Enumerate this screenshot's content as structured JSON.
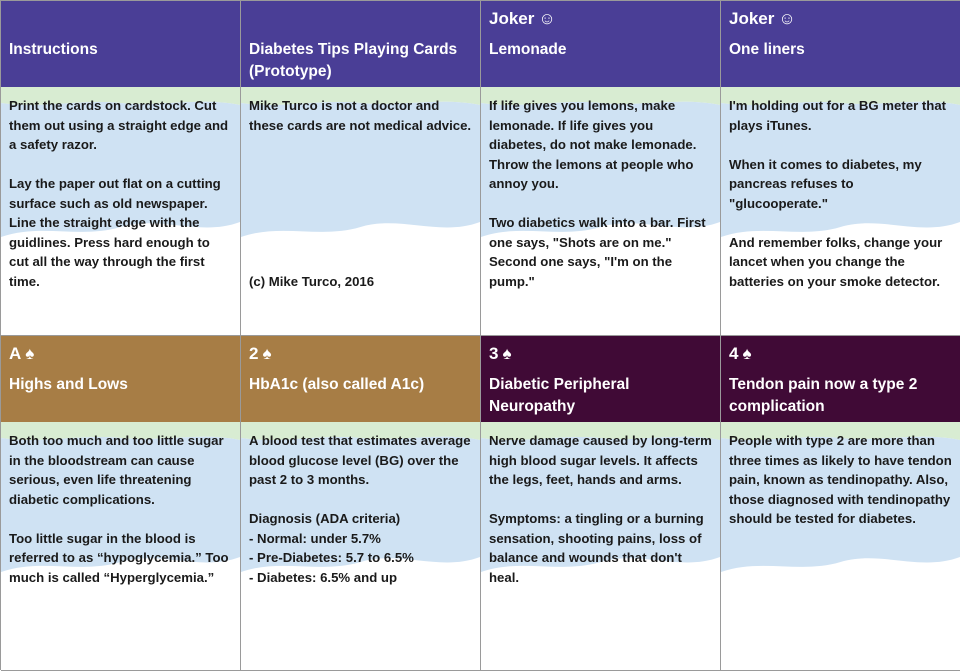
{
  "cards": [
    {
      "rank": "",
      "title": "Instructions",
      "body": [
        "Print the cards on cardstock. Cut them out using a straight edge and a safety razor.",
        "Lay the paper out flat on a cutting surface such as old newspaper. Line the straight edge with the guidlines. Press hard enough to cut all the way through the first time."
      ],
      "footer": "",
      "header_color": "#4a3e96"
    },
    {
      "rank": "",
      "title": "Diabetes Tips Playing Cards (Prototype)",
      "body": [
        "Mike Turco is not a doctor and these cards are not medical advice."
      ],
      "footer": "(c) Mike Turco, 2016",
      "header_color": "#4a3e96"
    },
    {
      "rank": "Joker",
      "rank_symbol": "☺",
      "title": "Lemonade",
      "body": [
        "If life gives you lemons, make lemonade. If life gives you diabetes, do not make lemonade. Throw the lemons at people who annoy you.",
        "Two diabetics walk into a bar. First one says, \"Shots are on me.\" Second one says, \"I'm on the pump.\""
      ],
      "footer": "",
      "header_color": "#4a3e96"
    },
    {
      "rank": "Joker",
      "rank_symbol": "☺",
      "title": "One liners",
      "body": [
        "I'm holding out for a BG meter that plays iTunes.",
        "When it comes to diabetes, my pancreas refuses to \"glucooperate.\"",
        "And remember folks, change your lancet when you change the batteries on your smoke detector."
      ],
      "footer": "",
      "header_color": "#4a3e96"
    },
    {
      "rank": "A",
      "rank_symbol": "♠",
      "title": "Highs and Lows",
      "body": [
        "Both too much and too little sugar in the bloodstream can cause serious, even life threatening diabetic complications.",
        "Too little sugar in the blood is referred to as “hypoglycemia.” Too much is called “Hyperglycemia.”"
      ],
      "footer": "",
      "header_color": "#a77d45"
    },
    {
      "rank": "2",
      "rank_symbol": "♠",
      "title": "HbA1c (also called A1c)",
      "body": [
        "A blood test that estimates average blood glucose level (BG) over the past 2 to 3 months.",
        "Diagnosis (ADA criteria)\n- Normal: under 5.7%\n- Pre-Diabetes: 5.7 to 6.5%\n- Diabetes: 6.5% and up"
      ],
      "footer": "",
      "header_color": "#a77d45"
    },
    {
      "rank": "3",
      "rank_symbol": "♠",
      "title": "Diabetic Peripheral Neuropathy",
      "body": [
        "Nerve damage caused by long-term high blood sugar levels. It affects the legs, feet, hands and arms.",
        "Symptoms: a tingling or a burning sensation, shooting pains, loss of balance and wounds that don't heal."
      ],
      "footer": "",
      "header_color": "#400a36"
    },
    {
      "rank": "4",
      "rank_symbol": "♠",
      "title": "Tendon pain now a type 2 complication",
      "body": [
        "People with type 2 are more than three times as likely to have tendon pain, known as tendinopathy. Also, those diagnosed with tendinopathy should be tested for diabetes."
      ],
      "footer": "",
      "header_color": "#400a36"
    }
  ]
}
